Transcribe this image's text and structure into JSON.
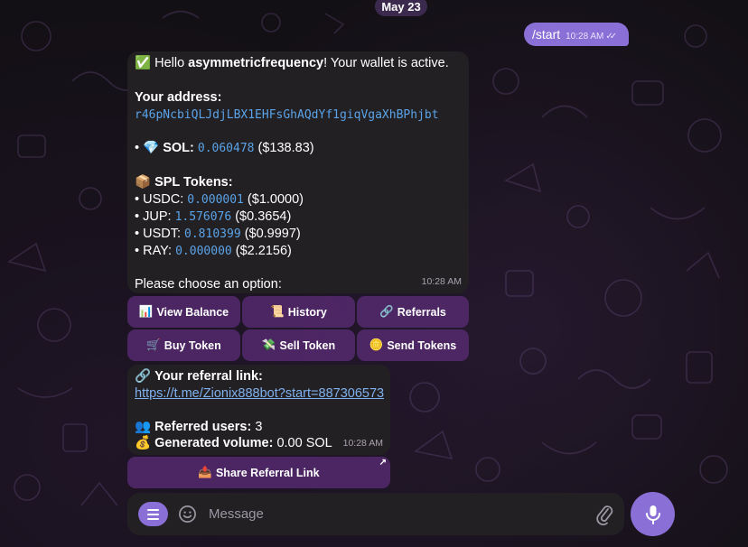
{
  "date_label": "May 23",
  "outgoing": {
    "text": "/start",
    "time": "10:28 AM",
    "ticks": "✓✓"
  },
  "bot_message": {
    "greeting_emoji": "✅",
    "greeting_prefix": "Hello ",
    "username": "asymmetricfrequency",
    "greeting_suffix": "! Your wallet is active.",
    "address_label": "Your address:",
    "address": "r46pNcbiQLJdjLBX1EHFsGhAQdYf1giqVgaXhBPhjbt",
    "sol": {
      "bullet": "•",
      "emoji": "💎",
      "label": "SOL:",
      "amount": "0.060478",
      "usd": "($138.83)"
    },
    "spl_header": {
      "emoji": "📦",
      "label": "SPL Tokens:"
    },
    "tokens": [
      {
        "label": "• USDC:",
        "amount": "0.000001",
        "usd": "($1.0000)"
      },
      {
        "label": "• JUP:",
        "amount": "1.576076",
        "usd": "($0.3654)"
      },
      {
        "label": "• USDT:",
        "amount": "0.810399",
        "usd": "($0.9997)"
      },
      {
        "label": "• RAY:",
        "amount": "0.000000",
        "usd": "($2.2156)"
      }
    ],
    "prompt": "Please choose an option:",
    "time": "10:28 AM"
  },
  "keyboard": [
    {
      "emoji": "📊",
      "label": "View Balance"
    },
    {
      "emoji": "📜",
      "label": "History"
    },
    {
      "emoji": "🔗",
      "label": "Referrals"
    },
    {
      "emoji": "🛒",
      "label": "Buy Token"
    },
    {
      "emoji": "💸",
      "label": "Sell Token"
    },
    {
      "emoji": "🪙",
      "label": "Send Tokens"
    }
  ],
  "referral_message": {
    "link_emoji": "🔗",
    "link_label": "Your referral link:",
    "link_url": "https://t.me/Zionix888bot?start=887306573",
    "users_emoji": "👥",
    "users_label": "Referred users:",
    "users_count": "3",
    "volume_emoji": "💰",
    "volume_label": "Generated volume:",
    "volume_value": "0.00 SOL",
    "time": "10:28 AM"
  },
  "share_button": {
    "emoji": "📤",
    "label": "Share Referral Link",
    "arrow": "↗"
  },
  "composer": {
    "placeholder": "Message"
  },
  "colors": {
    "accent": "#8a6fd6",
    "link": "#7fb1ee",
    "mono": "#5aa3e8",
    "button": "#53296c"
  }
}
